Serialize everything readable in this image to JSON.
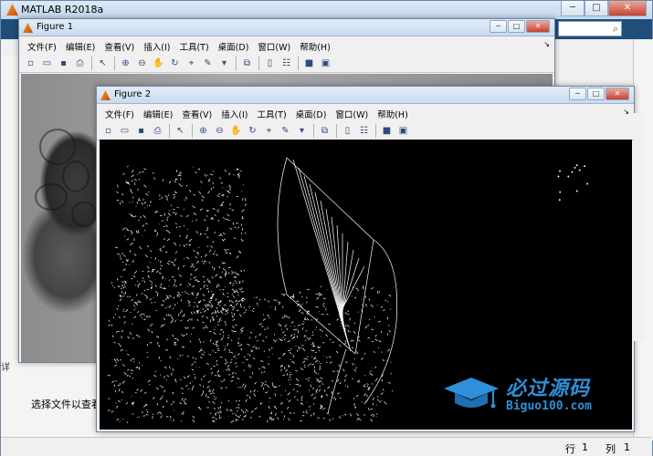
{
  "main": {
    "title": "MATLAB R2018a",
    "caption_min": "─",
    "caption_max": "□",
    "caption_close": "✕",
    "search_icon": "⌕",
    "select_hint": "选择文件以查看详",
    "side_collapsed": "详",
    "status": {
      "row_label": "行",
      "row_value": "1",
      "col_label": "列",
      "col_value": "1"
    }
  },
  "figures": [
    {
      "title": "Figure 1",
      "menus": [
        "文件(F)",
        "编辑(E)",
        "查看(V)",
        "插入(I)",
        "工具(T)",
        "桌面(D)",
        "窗口(W)",
        "帮助(H)"
      ],
      "dock_arrow": "↘"
    },
    {
      "title": "Figure 2",
      "menus": [
        "文件(F)",
        "编辑(E)",
        "查看(V)",
        "插入(I)",
        "工具(T)",
        "桌面(D)",
        "窗口(W)",
        "帮助(H)"
      ],
      "dock_arrow": "↘"
    }
  ],
  "toolbar_icons": [
    {
      "name": "new-figure-icon",
      "glyph": "▫"
    },
    {
      "name": "open-file-icon",
      "glyph": "▭"
    },
    {
      "name": "save-icon",
      "glyph": "▪"
    },
    {
      "name": "print-icon",
      "glyph": "⎙"
    },
    {
      "sep": true
    },
    {
      "name": "pointer-icon",
      "glyph": "↖"
    },
    {
      "sep": true
    },
    {
      "name": "zoom-in-icon",
      "glyph": "⊕"
    },
    {
      "name": "zoom-out-icon",
      "glyph": "⊖"
    },
    {
      "name": "pan-icon",
      "glyph": "✋"
    },
    {
      "name": "rotate-3d-icon",
      "glyph": "↻"
    },
    {
      "name": "data-cursor-icon",
      "glyph": "⌖"
    },
    {
      "name": "brush-icon",
      "glyph": "✎"
    },
    {
      "name": "brush-dropdown-icon",
      "glyph": "▾"
    },
    {
      "sep": true
    },
    {
      "name": "link-plot-icon",
      "glyph": "⧉"
    },
    {
      "sep": true
    },
    {
      "name": "colorbar-icon",
      "glyph": "▯"
    },
    {
      "name": "legend-icon",
      "glyph": "☷"
    },
    {
      "sep": true
    },
    {
      "name": "hide-tools-icon",
      "glyph": "■"
    },
    {
      "name": "dock-icon",
      "glyph": "▣"
    }
  ],
  "watermark": {
    "cn": "必过源码",
    "en": "Biguo100.com"
  }
}
